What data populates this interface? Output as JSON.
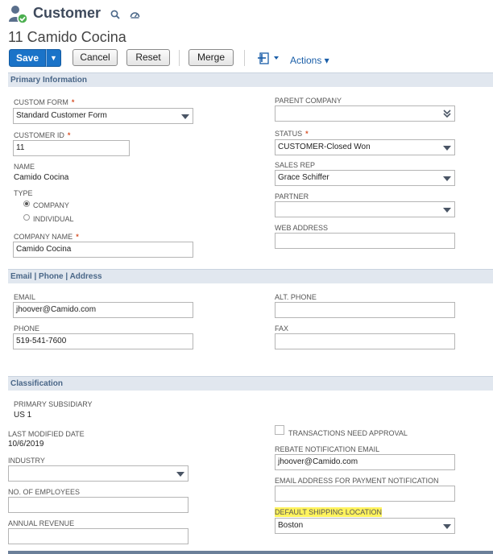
{
  "header": {
    "title": "Customer",
    "record_name": "11 Camido Cocina"
  },
  "toolbar": {
    "save_label": "Save",
    "save_arrow": "▼",
    "cancel_label": "Cancel",
    "reset_label": "Reset",
    "merge_label": "Merge",
    "actions_label": "Actions ▾"
  },
  "sections": {
    "primary": "Primary Information",
    "contact": "Email | Phone | Address",
    "classification": "Classification"
  },
  "primary": {
    "custom_form_label": "CUSTOM FORM",
    "custom_form_value": "Standard Customer Form",
    "customer_id_label": "CUSTOMER ID",
    "customer_id_value": "11",
    "name_label": "NAME",
    "name_value": "Camido Cocina",
    "type_label": "TYPE",
    "type_option_company": "COMPANY",
    "type_option_individual": "INDIVIDUAL",
    "company_name_label": "COMPANY NAME",
    "company_name_value": "Camido Cocina",
    "parent_company_label": "PARENT COMPANY",
    "parent_company_value": "",
    "status_label": "STATUS",
    "status_value": "CUSTOMER-Closed Won",
    "sales_rep_label": "SALES REP",
    "sales_rep_value": "Grace Schiffer",
    "partner_label": "PARTNER",
    "partner_value": "",
    "web_address_label": "WEB ADDRESS",
    "web_address_value": "",
    "required_mark": "*"
  },
  "contact": {
    "email_label": "EMAIL",
    "email_value": "jhoover@Camido.com",
    "phone_label": "PHONE",
    "phone_value": "519-541-7600",
    "alt_phone_label": "ALT. PHONE",
    "alt_phone_value": "",
    "fax_label": "FAX",
    "fax_value": ""
  },
  "classification": {
    "primary_subsidiary_label": "PRIMARY SUBSIDIARY",
    "primary_subsidiary_value": "US 1",
    "last_modified_label": "LAST MODIFIED DATE",
    "last_modified_value": "10/6/2019",
    "industry_label": "INDUSTRY",
    "industry_value": "",
    "employees_label": "NO. OF EMPLOYEES",
    "employees_value": "",
    "annual_revenue_label": "ANNUAL REVENUE",
    "annual_revenue_value": "",
    "transactions_approval_label": "TRANSACTIONS NEED APPROVAL",
    "rebate_email_label": "REBATE NOTIFICATION EMAIL",
    "rebate_email_value": "jhoover@Camido.com",
    "payment_email_label": "EMAIL ADDRESS FOR PAYMENT NOTIFICATION",
    "payment_email_value": "",
    "shipping_location_label": "DEFAULT SHIPPING LOCATION",
    "shipping_location_value": "Boston"
  },
  "colors": {
    "accent": "#1a73c8",
    "section_bg": "#e1e7ef",
    "highlight": "#fff35c"
  }
}
